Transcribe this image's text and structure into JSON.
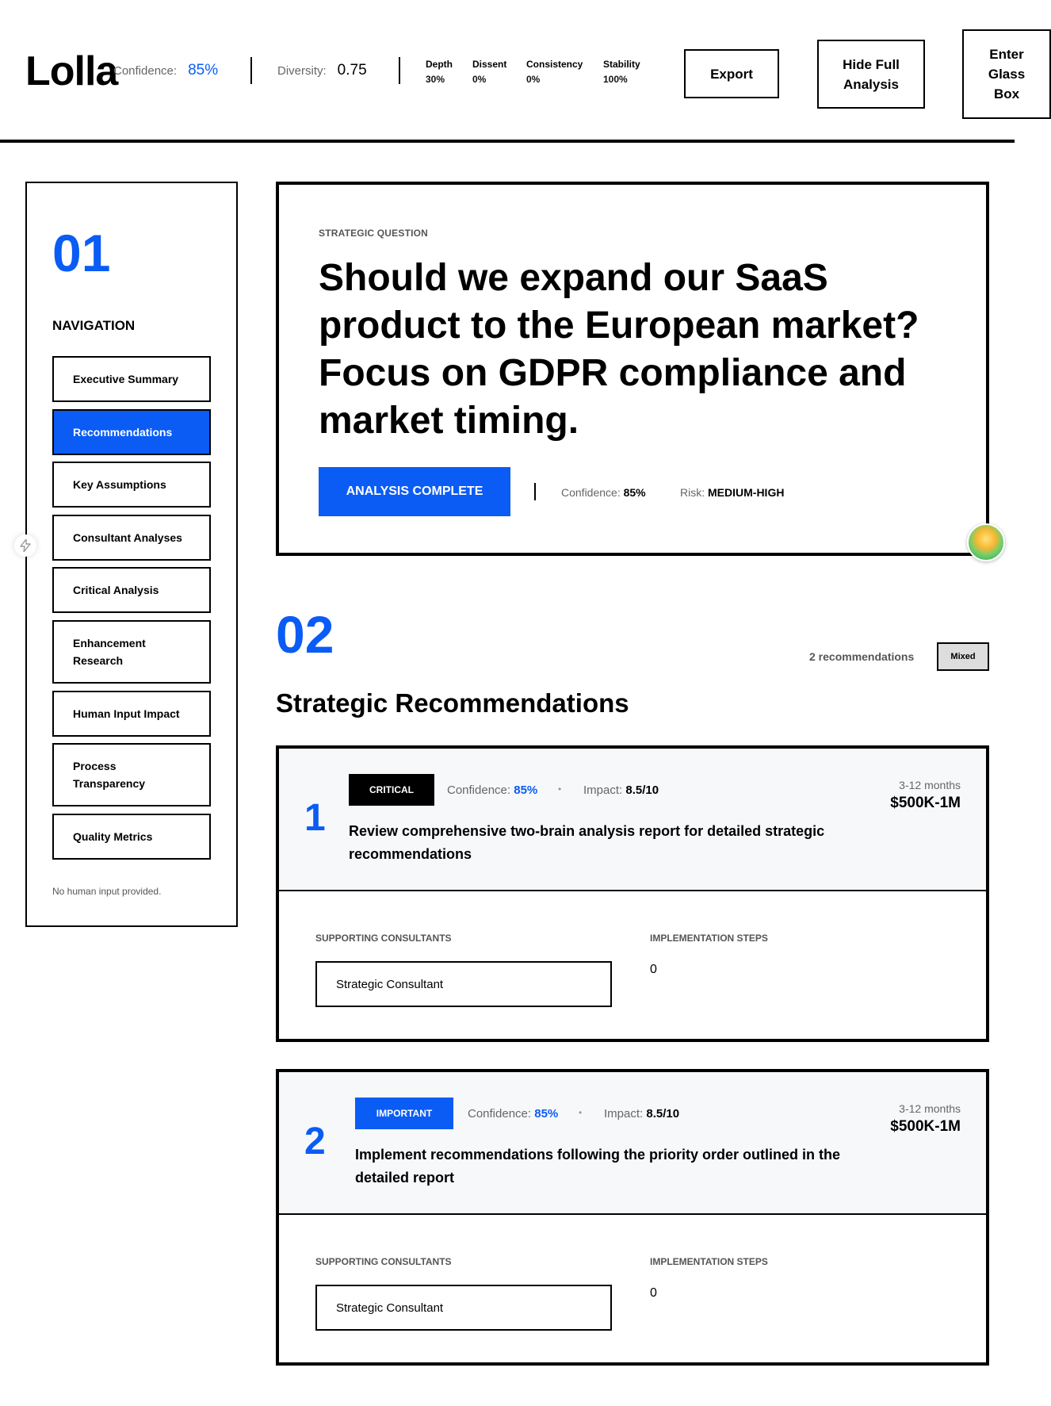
{
  "header": {
    "logo": "Lolla",
    "confidence_label": "Confidence:",
    "confidence_value": "85%",
    "diversity_label": "Diversity:",
    "diversity_value": "0.75",
    "mini_metrics": [
      {
        "label": "Depth",
        "value": "30%"
      },
      {
        "label": "Dissent",
        "value": "0%"
      },
      {
        "label": "Consistency",
        "value": "0%"
      },
      {
        "label": "Stability",
        "value": "100%"
      }
    ],
    "export_label": "Export",
    "hide_label": "Hide Full Analysis",
    "glass_label": "Enter Glass Box"
  },
  "sidebar": {
    "number": "01",
    "title": "NAVIGATION",
    "items": [
      {
        "label": "Executive Summary"
      },
      {
        "label": "Recommendations"
      },
      {
        "label": "Key Assumptions"
      },
      {
        "label": "Consultant Analyses"
      },
      {
        "label": "Critical Analysis"
      },
      {
        "label": "Enhancement Research"
      },
      {
        "label": "Human Input Impact"
      },
      {
        "label": "Process Transparency"
      },
      {
        "label": "Quality Metrics"
      }
    ],
    "active_index": 1,
    "note": "No human input provided."
  },
  "question": {
    "label": "STRATEGIC QUESTION",
    "text": "Should we expand our SaaS product to the European market? Focus on GDPR compliance and market timing.",
    "badge": "ANALYSIS COMPLETE",
    "confidence_label": "Confidence:",
    "confidence_value": "85%",
    "risk_label": "Risk:",
    "risk_value": "MEDIUM-HIGH"
  },
  "section2": {
    "number": "02",
    "title": "Strategic Recommendations",
    "count": "2 recommendations",
    "mixed": "Mixed"
  },
  "recommendations": [
    {
      "number": "1",
      "tag": "CRITICAL",
      "confidence_label": "Confidence:",
      "confidence_value": "85%",
      "dot": "•",
      "impact_label": "Impact:",
      "impact_value": "8.5/10",
      "duration": "3-12 months",
      "cost": "$500K-1M",
      "text": "Review comprehensive two-brain analysis report for detailed strategic recommendations",
      "supporting_label": "SUPPORTING CONSULTANTS",
      "consultant": "Strategic Consultant",
      "steps_label": "IMPLEMENTATION STEPS",
      "steps_value": "0"
    },
    {
      "number": "2",
      "tag": "IMPORTANT",
      "confidence_label": "Confidence:",
      "confidence_value": "85%",
      "dot": "•",
      "impact_label": "Impact:",
      "impact_value": "8.5/10",
      "duration": "3-12 months",
      "cost": "$500K-1M",
      "text": "Implement recommendations following the priority order outlined in the detailed report",
      "supporting_label": "SUPPORTING CONSULTANTS",
      "consultant": "Strategic Consultant",
      "steps_label": "IMPLEMENTATION STEPS",
      "steps_value": "0"
    }
  ],
  "colors": {
    "accent": "#0a5cf5",
    "card_top_bg": "#f7f8fa"
  },
  "icons": {
    "side_handle": "bolt-icon",
    "avatar": "avatar"
  }
}
